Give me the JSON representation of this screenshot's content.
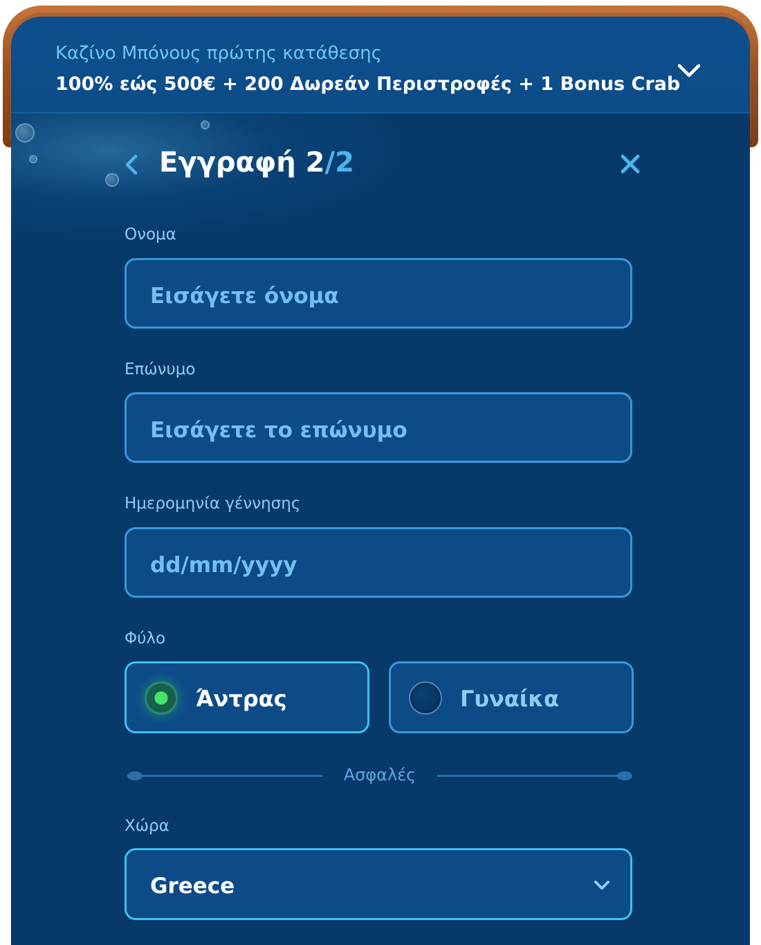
{
  "banner": {
    "title": "Καζίνο Μπόνους πρώτης κατάθεσης",
    "offer": "100% εώς 500€ + 200 Δωρεάν Περιστροφές + 1 Bonus Crab",
    "expand_icon": "chevron-down-icon"
  },
  "header": {
    "title": "Εγγραφή 2",
    "step_separator": "/",
    "step_total": "2",
    "back_icon": "chevron-left-icon",
    "close_icon": "close-icon"
  },
  "form": {
    "first_name": {
      "label": "Ονομα",
      "placeholder": "Εισάγετε όνομα",
      "value": ""
    },
    "last_name": {
      "label": "Επώνυμο",
      "placeholder": "Εισάγετε το επώνυμο",
      "value": ""
    },
    "birth_date": {
      "label": "Ημερομηνία γέννησης",
      "placeholder": "dd/mm/yyyy",
      "value": ""
    },
    "gender": {
      "label": "Φύλο",
      "options": [
        {
          "label": "Άντρας",
          "selected": true
        },
        {
          "label": "Γυναίκα",
          "selected": false
        }
      ]
    },
    "secure_divider": "Ασφαλές",
    "country": {
      "label": "Χώρα",
      "selected": "Greece"
    }
  },
  "colors": {
    "panel_bg": "#073a6b",
    "field_bg": "#0d4b87",
    "field_border": "#3a98dc",
    "accent_light_blue": "#4fb3ec",
    "selected_radio_green": "#44e36b",
    "wood_frame": "#9a5223"
  }
}
